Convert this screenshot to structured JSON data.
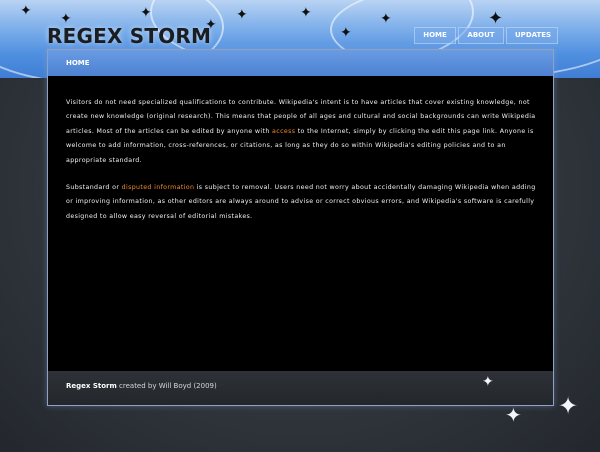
{
  "header": {
    "site_title": "REGEX STORM",
    "nav": [
      {
        "label": "HOME"
      },
      {
        "label": "ABOUT"
      },
      {
        "label": "UPDATES"
      }
    ]
  },
  "breadcrumb": "HOME",
  "content": {
    "p1": {
      "before": "Visitors do not need specialized qualifications to contribute. Wikipedia's intent is to have articles that cover existing knowledge, not create new knowledge (original research). This means that people of all ages and cultural and social backgrounds can write Wikipedia articles. Most of the articles can be edited by anyone with ",
      "link": "access",
      "after": " to the Internet, simply by clicking the edit this page link. Anyone is welcome to add information, cross-references, or citations, as long as they do so within Wikipedia's editing policies and to an appropriate standard."
    },
    "p2": {
      "before": "Substandard or ",
      "link": "disputed information",
      "after": " is subject to removal. Users need not worry about accidentally damaging Wikipedia when adding or improving information, as other editors are always around to advise or correct obvious errors, and Wikipedia's software is carefully designed to allow easy reversal of editorial mistakes."
    }
  },
  "footer": {
    "brand": "Regex Storm",
    "credit_text": " created by Will Boyd (2009)"
  },
  "colors": {
    "link": "#f08a2c",
    "sky": "#4f8fe0",
    "panel_bg": "#000000"
  },
  "icons": [
    "maple-leaf-icon"
  ]
}
